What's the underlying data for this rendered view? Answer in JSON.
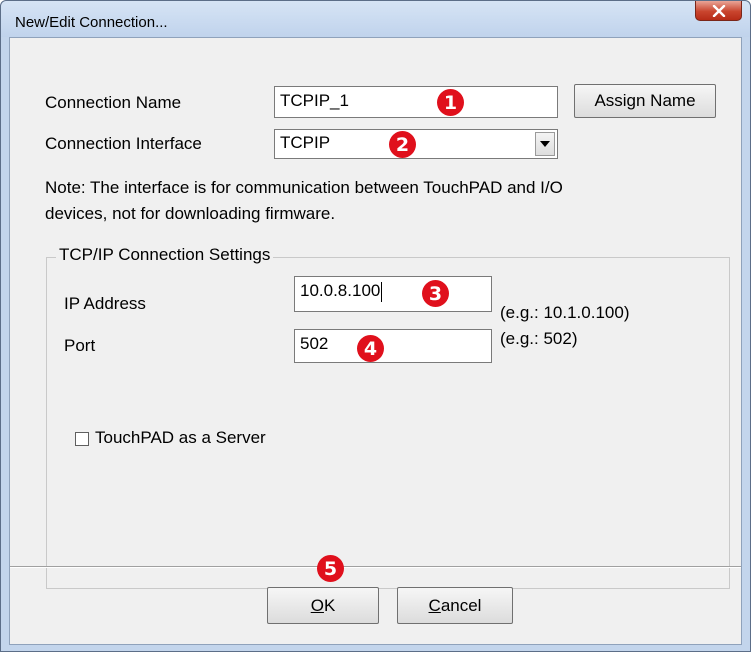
{
  "window": {
    "title": "New/Edit Connection..."
  },
  "connection": {
    "name_label": "Connection Name",
    "name_value": "TCPIP_1",
    "assign_button": "Assign Name",
    "interface_label": "Connection Interface",
    "interface_value": "TCPIP"
  },
  "note": {
    "line1": "Note: The interface is for communication between TouchPAD and I/O",
    "line2": "devices, not for downloading firmware."
  },
  "tcpip_group": {
    "title": "TCP/IP Connection Settings",
    "ip_label": "IP Address",
    "ip_value": "10.0.8.100",
    "ip_hint": "(e.g.: 10.1.0.100)",
    "port_label": "Port",
    "port_value": "502",
    "port_hint": "(e.g.: 502)",
    "server_checkbox_label": "TouchPAD as a Server",
    "server_checked": false
  },
  "buttons": {
    "ok_access": "O",
    "ok_rest": "K",
    "cancel_access": "C",
    "cancel_rest": "ancel"
  },
  "badges": [
    "1",
    "2",
    "3",
    "4",
    "5"
  ],
  "colors": {
    "badge": "#e0101c",
    "dialog_bg": "#f0f0f0",
    "frame": "#c3d5ec",
    "close_button": "#c9452e"
  },
  "icons": {
    "close": "close-x-icon",
    "dropdown": "chevron-down-icon"
  }
}
